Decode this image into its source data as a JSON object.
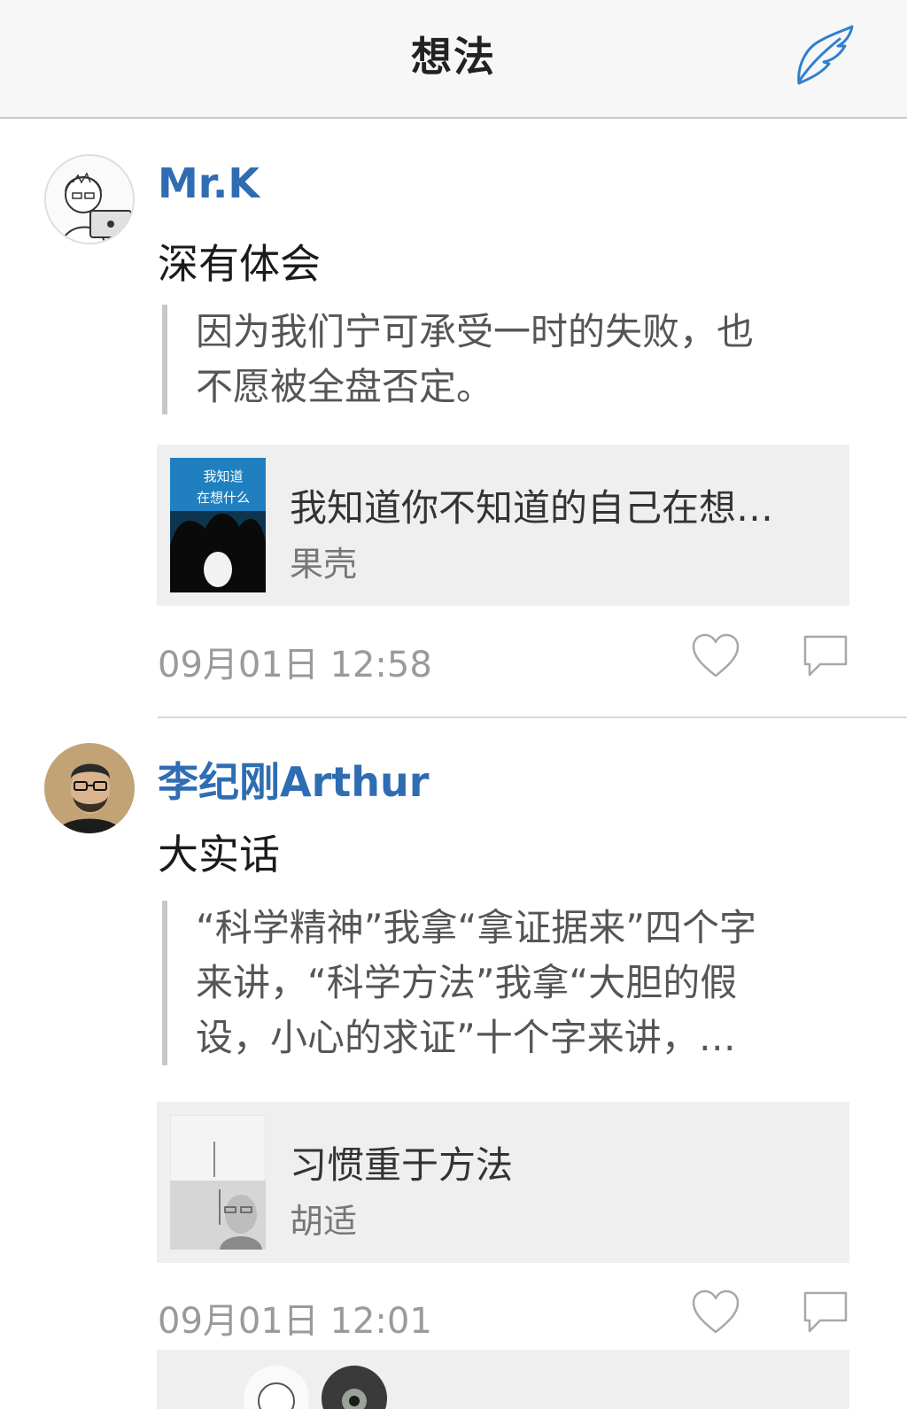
{
  "header": {
    "title": "想法",
    "compose_icon": "quill-icon"
  },
  "posts": [
    {
      "username": "Mr.K",
      "comment": "深有体会",
      "quote_lines": [
        "因为我们宁可承受一时的失败，也",
        "不愿被全盘否定。"
      ],
      "book": {
        "title": "我知道你不知道的自己在想…",
        "author": "果壳",
        "cover_text": [
          "我知道",
          "在想什么"
        ]
      },
      "timestamp": "09月01日 12:58",
      "like_icon": "heart-icon",
      "comment_icon": "speech-bubble-icon"
    },
    {
      "username": "李纪刚Arthur",
      "comment": "大实话",
      "quote_lines": [
        "“科学精神”我拿“拿证据来”四个字",
        "来讲，“科学方法”我拿“大胆的假",
        "设，小心的求证”十个字来讲，…"
      ],
      "book": {
        "title": "习惯重于方法",
        "author": "胡适"
      },
      "timestamp": "09月01日 12:01",
      "like_icon": "heart-icon",
      "comment_icon": "speech-bubble-icon"
    }
  ],
  "colors": {
    "link_blue": "#2f6db3",
    "nav_bg": "#f7f7f7",
    "card_bg": "#efefef",
    "muted_text": "#9a9a9a"
  }
}
